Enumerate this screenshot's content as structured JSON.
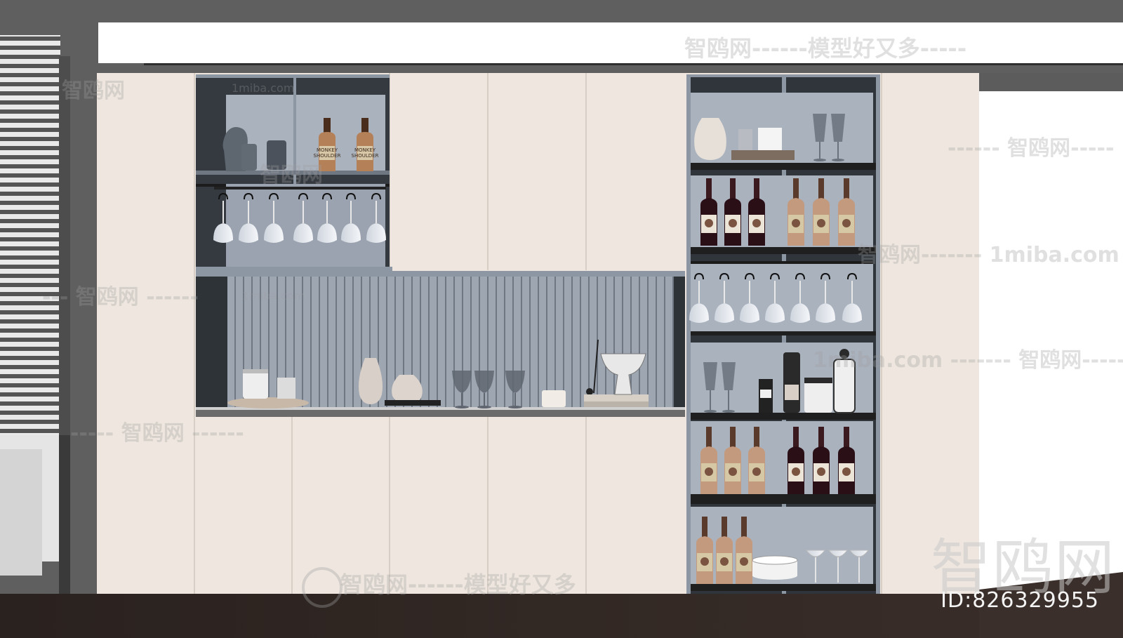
{
  "watermarks": {
    "top_banner": "智鸥网------模型好又多-----",
    "bottom_banner": "智鸥网------模型好又多",
    "left_1": "智鸥网",
    "left_2": "--- 智鸥网 ------",
    "left_3": "----- 智鸥网 ------",
    "shelf_brand": "智鸥网",
    "right_1": "------ 智鸥网-----",
    "right_2": "智鸥网------- 1miba.com",
    "right_3": "1miba.com ------- 智鸥网---------",
    "small_site_1": "1miba.com",
    "small_site_2": "1miba.com",
    "corner_logo": "智鸥网"
  },
  "id_label": "ID:826329955",
  "bottle_labels": {
    "whisky_line1": "MONKEY",
    "whisky_line2": "SHOULDER"
  }
}
